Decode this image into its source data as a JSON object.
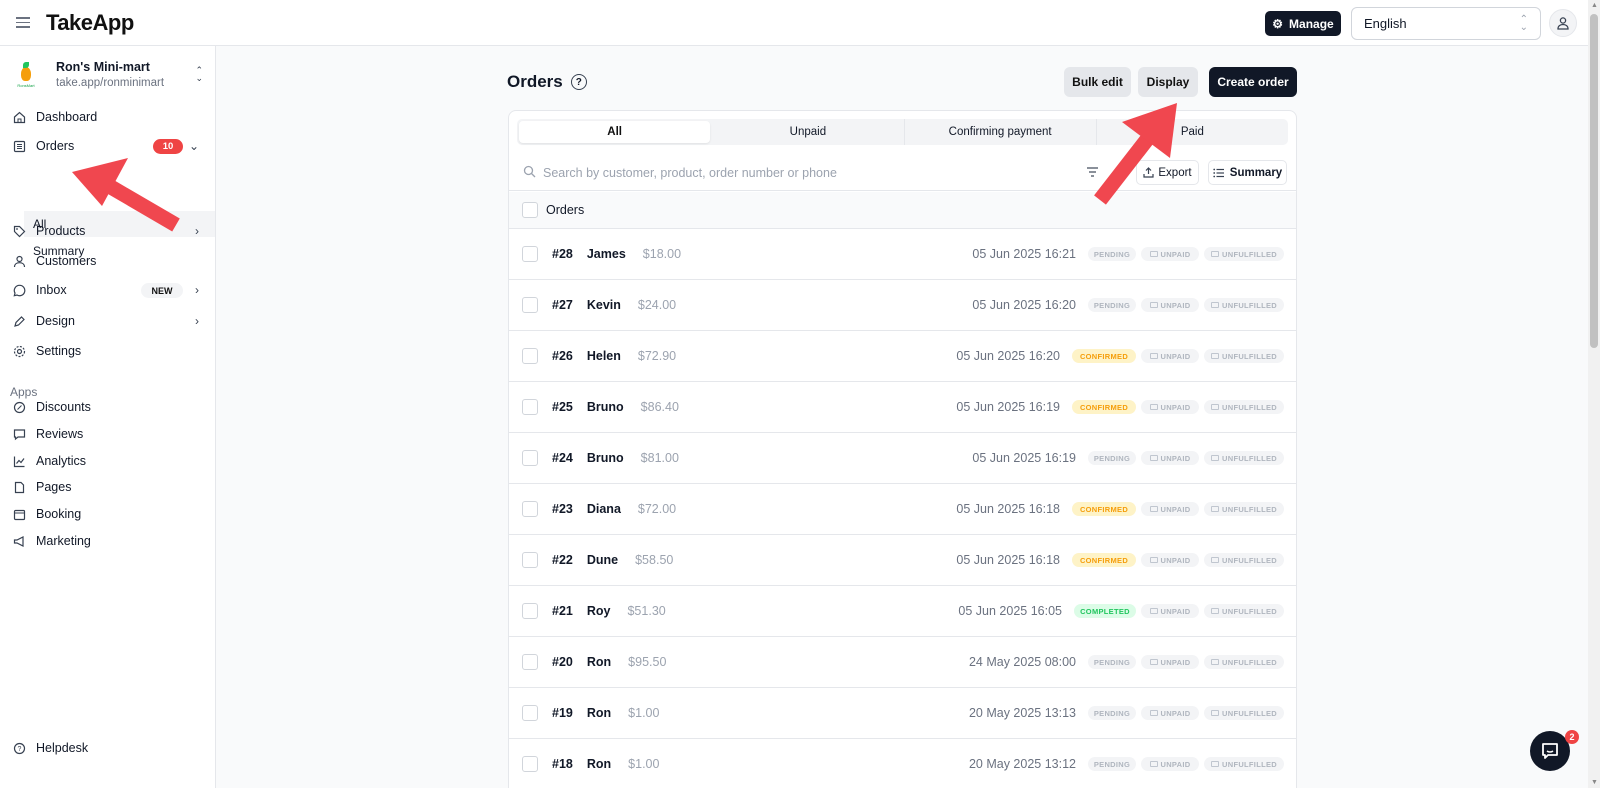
{
  "app": {
    "title": "TakeApp"
  },
  "topbar": {
    "manage_label": "Manage",
    "language": "English"
  },
  "store": {
    "name": "Ron's Mini-mart",
    "url": "take.app/ronminimart",
    "logo_text": "RonsMart"
  },
  "sidebar": {
    "dashboard": "Dashboard",
    "orders": "Orders",
    "orders_badge": "10",
    "orders_all": "All",
    "orders_summary": "Summary",
    "products": "Products",
    "customers": "Customers",
    "inbox": "Inbox",
    "inbox_badge": "NEW",
    "design": "Design",
    "settings": "Settings",
    "apps_label": "Apps",
    "discounts": "Discounts",
    "reviews": "Reviews",
    "analytics": "Analytics",
    "pages": "Pages",
    "booking": "Booking",
    "marketing": "Marketing",
    "helpdesk": "Helpdesk"
  },
  "main": {
    "title": "Orders",
    "bulk_edit": "Bulk edit",
    "display": "Display",
    "create_order": "Create order",
    "tabs": [
      "All",
      "Unpaid",
      "Confirming payment",
      "Paid"
    ],
    "search_placeholder": "Search by customer, product, order number or phone",
    "export": "Export",
    "summary": "Summary",
    "list_header": "Orders"
  },
  "orders": [
    {
      "num": "#28",
      "customer": "James",
      "amount": "$18.00",
      "date": "05 Jun 2025 16:21",
      "status": "PENDING",
      "payment": "UNPAID",
      "fulfillment": "UNFULFILLED"
    },
    {
      "num": "#27",
      "customer": "Kevin",
      "amount": "$24.00",
      "date": "05 Jun 2025 16:20",
      "status": "PENDING",
      "payment": "UNPAID",
      "fulfillment": "UNFULFILLED"
    },
    {
      "num": "#26",
      "customer": "Helen",
      "amount": "$72.90",
      "date": "05 Jun 2025 16:20",
      "status": "CONFIRMED",
      "payment": "UNPAID",
      "fulfillment": "UNFULFILLED"
    },
    {
      "num": "#25",
      "customer": "Bruno",
      "amount": "$86.40",
      "date": "05 Jun 2025 16:19",
      "status": "CONFIRMED",
      "payment": "UNPAID",
      "fulfillment": "UNFULFILLED"
    },
    {
      "num": "#24",
      "customer": "Bruno",
      "amount": "$81.00",
      "date": "05 Jun 2025 16:19",
      "status": "PENDING",
      "payment": "UNPAID",
      "fulfillment": "UNFULFILLED"
    },
    {
      "num": "#23",
      "customer": "Diana",
      "amount": "$72.00",
      "date": "05 Jun 2025 16:18",
      "status": "CONFIRMED",
      "payment": "UNPAID",
      "fulfillment": "UNFULFILLED"
    },
    {
      "num": "#22",
      "customer": "Dune",
      "amount": "$58.50",
      "date": "05 Jun 2025 16:18",
      "status": "CONFIRMED",
      "payment": "UNPAID",
      "fulfillment": "UNFULFILLED"
    },
    {
      "num": "#21",
      "customer": "Roy",
      "amount": "$51.30",
      "date": "05 Jun 2025 16:05",
      "status": "COMPLETED",
      "payment": "UNPAID",
      "fulfillment": "UNFULFILLED"
    },
    {
      "num": "#20",
      "customer": "Ron",
      "amount": "$95.50",
      "date": "24 May 2025 08:00",
      "status": "PENDING",
      "payment": "UNPAID",
      "fulfillment": "UNFULFILLED"
    },
    {
      "num": "#19",
      "customer": "Ron",
      "amount": "$1.00",
      "date": "20 May 2025 13:13",
      "status": "PENDING",
      "payment": "UNPAID",
      "fulfillment": "UNFULFILLED"
    },
    {
      "num": "#18",
      "customer": "Ron",
      "amount": "$1.00",
      "date": "20 May 2025 13:12",
      "status": "PENDING",
      "payment": "UNPAID",
      "fulfillment": "UNFULFILLED"
    }
  ],
  "chat": {
    "badge": "2"
  },
  "colors": {
    "accent": "#111827",
    "badge_red": "#ef4444",
    "annotation_arrow": "#f0474f",
    "confirmed": "#f59e0b",
    "completed": "#22c55e"
  }
}
